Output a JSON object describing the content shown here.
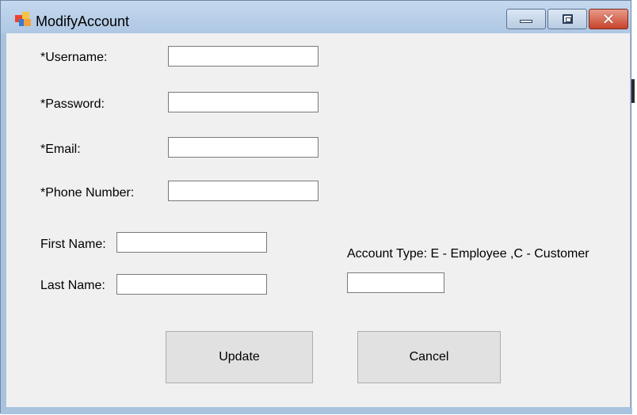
{
  "window": {
    "title": "ModifyAccount",
    "minimize_label": "",
    "maximize_label": "",
    "close_label": "✕"
  },
  "form": {
    "username_label": "*Username:",
    "password_label": "*Password:",
    "email_label": "*Email:",
    "phone_label": "*Phone Number:",
    "first_name_label": "First Name:",
    "last_name_label": "Last Name:",
    "account_type_label": "Account Type: E - Employee ,C - Customer",
    "username_value": "",
    "password_value": "",
    "email_value": "",
    "phone_value": "",
    "first_name_value": "",
    "last_name_value": "",
    "account_type_value": ""
  },
  "buttons": {
    "update_label": "Update",
    "cancel_label": "Cancel"
  },
  "colors": {
    "titlebar": "#aec7e3",
    "client_background": "#f0f0f0",
    "button_face": "#e1e1e1",
    "close_button": "#c7432b"
  },
  "icons": {
    "app": "app-icon",
    "minimize": "minimize-icon",
    "maximize": "maximize-icon",
    "close": "close-icon"
  }
}
